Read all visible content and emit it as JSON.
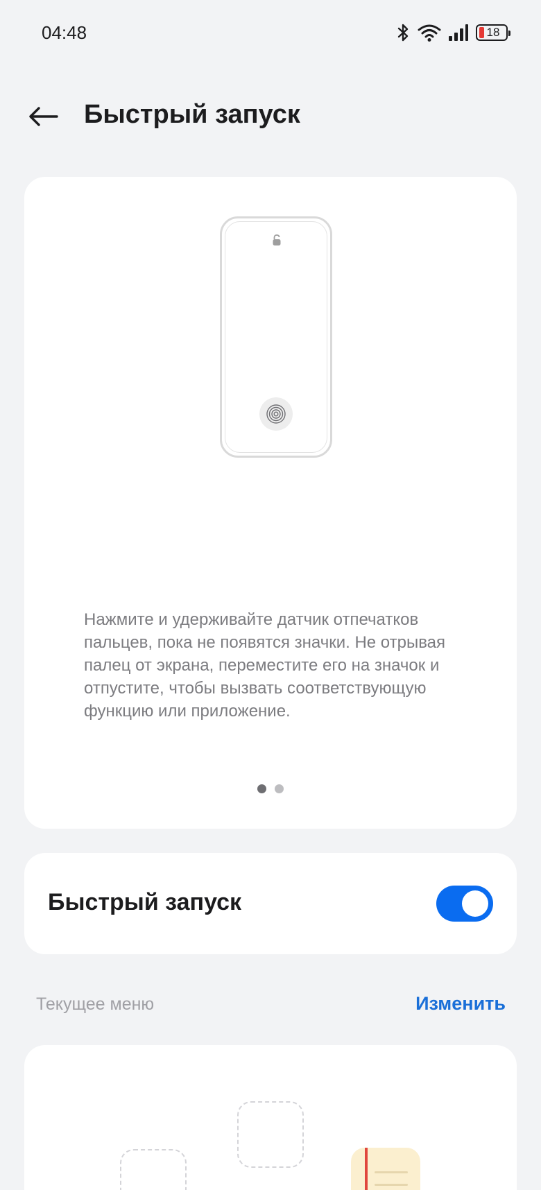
{
  "status_bar": {
    "time": "04:48",
    "battery_level": "18",
    "icons": [
      "bluetooth-icon",
      "wifi-icon",
      "signal-icon",
      "battery-icon"
    ]
  },
  "header": {
    "back_icon": "arrow-left-icon",
    "title": "Быстрый запуск"
  },
  "intro": {
    "description": "Нажмите и удерживайте датчик отпечатков пальцев, пока не появятся значки. Не отрывая палец от экрана, переместите его на значок и отпустите, чтобы вызвать соответствующую функцию или приложение.",
    "page_count": 2,
    "active_page": 1
  },
  "quick_launch": {
    "label": "Быстрый запуск",
    "enabled": true
  },
  "current_menu": {
    "title": "Текущее меню",
    "edit_label": "Изменить"
  },
  "colors": {
    "accent": "#0a6cf0",
    "link": "#1a6fd8",
    "background": "#f2f3f5",
    "battery_low": "#e53935",
    "notes_app": "#fbefcf"
  }
}
